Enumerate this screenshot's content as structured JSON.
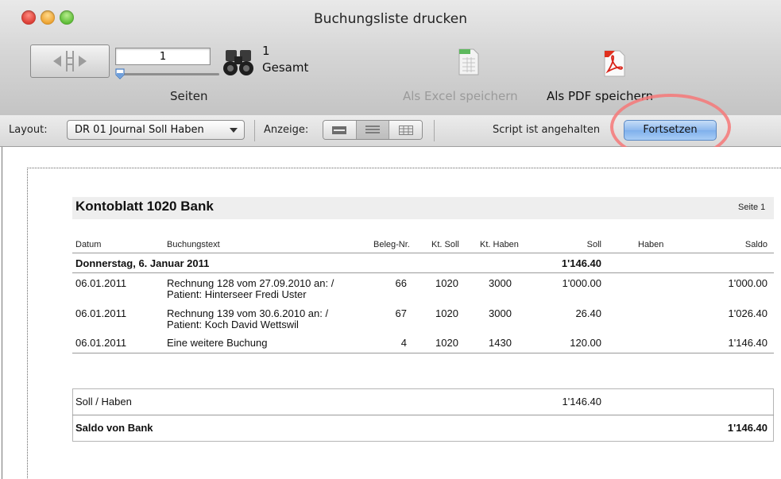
{
  "window": {
    "title": "Buchungsliste drucken"
  },
  "toolbar": {
    "page_number": "1",
    "total_count": "1",
    "total_label": "Gesamt",
    "pages_label": "Seiten",
    "excel_label": "Als Excel speichern",
    "pdf_label": "Als PDF speichern",
    "icons": [
      "page-prev-icon",
      "page-next-icon",
      "binoculars-icon",
      "excel-document-icon",
      "pdf-document-icon"
    ]
  },
  "subbar": {
    "layout_label": "Layout:",
    "layout_value": "DR 01 Journal Soll Haben",
    "display_label": "Anzeige:",
    "status_text": "Script ist angehalten",
    "continue_label": "Fortsetzen",
    "accent_color": "#8db8ee"
  },
  "report": {
    "title": "Kontoblatt 1020 Bank",
    "page_label": "Seite 1",
    "columns": [
      "Datum",
      "Buchungstext",
      "Beleg-Nr.",
      "Kt. Soll",
      "Kt. Haben",
      "Soll",
      "Haben",
      "Saldo"
    ],
    "group_label": "Donnerstag, 6. Januar 2011",
    "group_total": "1'146.40",
    "rows": [
      {
        "date": "06.01.2011",
        "text1": "Rechnung 128 vom 27.09.2010 an:  /",
        "text2": "Patient: Hinterseer Fredi Uster",
        "beleg": "66",
        "soll_acct": "1020",
        "haben_acct": "3000",
        "soll": "1'000.00",
        "haben": "",
        "saldo": "1'000.00"
      },
      {
        "date": "06.01.2011",
        "text1": "Rechnung 139 vom 30.6.2010 an:  /",
        "text2": "Patient: Koch David Wettswil",
        "beleg": "67",
        "soll_acct": "1020",
        "haben_acct": "3000",
        "soll": "26.40",
        "haben": "",
        "saldo": "1'026.40"
      },
      {
        "date": "06.01.2011",
        "text1": "Eine weitere Buchung",
        "text2": "",
        "beleg": "4",
        "soll_acct": "1020",
        "haben_acct": "1430",
        "soll": "120.00",
        "haben": "",
        "saldo": "1'146.40"
      }
    ],
    "summary": {
      "label": "Soll / Haben",
      "soll": "1'146.40",
      "saldo_label": "Saldo von Bank",
      "saldo_value": "1'146.40"
    }
  }
}
